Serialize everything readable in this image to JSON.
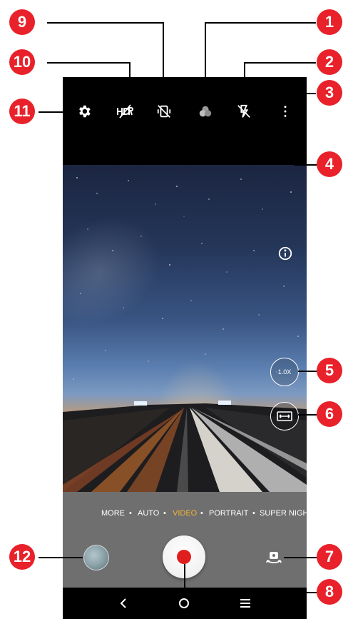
{
  "camera_modes": {
    "items": [
      "MORE",
      "AUTO",
      "VIDEO",
      "PORTRAIT",
      "SUPER NIGH"
    ],
    "selected": "VIDEO",
    "separator": "•"
  },
  "zoom": {
    "label": "1.0X"
  },
  "callouts": {
    "c1": "1",
    "c2": "2",
    "c3": "3",
    "c4": "4",
    "c5": "5",
    "c6": "6",
    "c7": "7",
    "c8": "8",
    "c9": "9",
    "c10": "10",
    "c11": "11",
    "c12": "12"
  },
  "icons": {
    "settings": "gear-icon",
    "hdr_off": "hdr-off-icon",
    "stabilization_off": "stabilization-off-icon",
    "filter": "filter-icon",
    "flash_off": "flash-off-icon",
    "more": "more-vert-icon",
    "info": "info-icon",
    "aspect_ratio": "aspect-ratio-icon",
    "switch_camera": "switch-camera-icon",
    "record": "record-icon",
    "back": "back-icon",
    "home": "home-icon",
    "recents": "recents-icon"
  },
  "colors": {
    "callout": "#e8212a",
    "selected_mode": "#f1b338",
    "record": "#e11e1e"
  }
}
